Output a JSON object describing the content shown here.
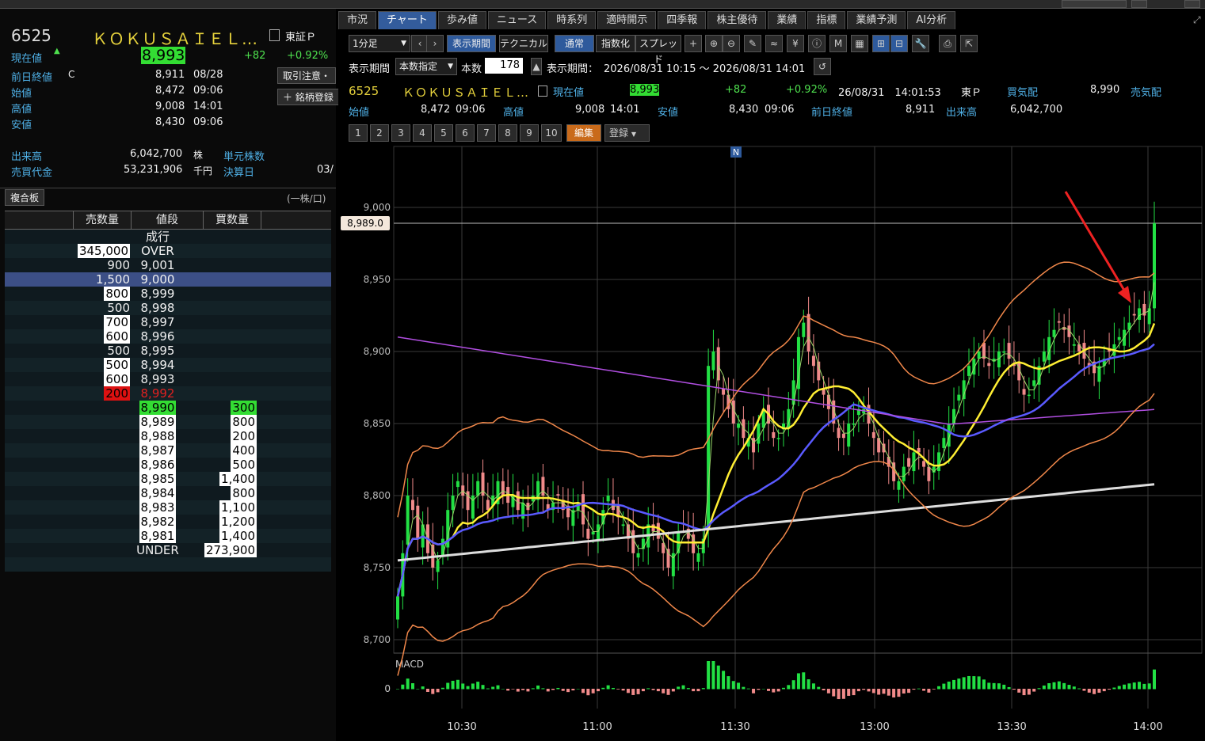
{
  "stock": {
    "code": "6525",
    "name": "ＫＯＫＵＳＡＩＥＬ…",
    "market": "東証Ｐ",
    "price_label": "現在値",
    "price": "8,993",
    "change": "+82",
    "change_pct": "+0.92%",
    "prev_close_label": "前日終値",
    "prev_close_flag": "C",
    "prev_close": "8,911",
    "prev_close_date": "08/28",
    "open_label": "始値",
    "open": "8,472",
    "open_time": "09:06",
    "high_label": "高値",
    "high": "9,008",
    "high_time": "14:01",
    "low_label": "安値",
    "low": "8,430",
    "low_time": "09:06",
    "volume_label": "出来高",
    "volume": "6,042,700",
    "volume_unit": "株",
    "trade_value_label": "売買代金",
    "trade_value": "53,231,906",
    "trade_value_unit": "千円",
    "unit_shares_label": "単元株数",
    "settlement_label": "決算日",
    "settlement_value": "03/",
    "trade_caution_btn": "取引注意・",
    "register_btn": "銘柄登録"
  },
  "book": {
    "title": "複合板",
    "unit": "(一株/口)",
    "headers": [
      "売数量",
      "値段",
      "買数量"
    ],
    "market_order": "成行",
    "rows": [
      {
        "ask": "345,000",
        "price": "OVER",
        "bid": "",
        "style": "box"
      },
      {
        "ask": "900",
        "price": "9,001",
        "bid": "",
        "style": ""
      },
      {
        "ask": "1,500",
        "price": "9,000",
        "bid": "",
        "style": "hl"
      },
      {
        "ask": "800",
        "price": "8,999",
        "bid": "",
        "style": "box"
      },
      {
        "ask": "500",
        "price": "8,998",
        "bid": "",
        "style": ""
      },
      {
        "ask": "700",
        "price": "8,997",
        "bid": "",
        "style": "box"
      },
      {
        "ask": "600",
        "price": "8,996",
        "bid": "",
        "style": "box"
      },
      {
        "ask": "500",
        "price": "8,995",
        "bid": "",
        "style": ""
      },
      {
        "ask": "500",
        "price": "8,994",
        "bid": "",
        "style": "box"
      },
      {
        "ask": "600",
        "price": "8,993",
        "bid": "",
        "style": "box"
      },
      {
        "ask": "200",
        "price": "8,992",
        "bid": "",
        "style": "red"
      },
      {
        "ask": "",
        "price": "8,990",
        "bid": "300",
        "style": "green"
      },
      {
        "ask": "",
        "price": "8,989",
        "bid": "800",
        "style": "boxb"
      },
      {
        "ask": "",
        "price": "8,988",
        "bid": "200",
        "style": "boxb"
      },
      {
        "ask": "",
        "price": "8,987",
        "bid": "400",
        "style": "boxb"
      },
      {
        "ask": "",
        "price": "8,986",
        "bid": "500",
        "style": "boxb"
      },
      {
        "ask": "",
        "price": "8,985",
        "bid": "1,400",
        "style": "boxb"
      },
      {
        "ask": "",
        "price": "8,984",
        "bid": "800",
        "style": "boxb"
      },
      {
        "ask": "",
        "price": "8,983",
        "bid": "1,100",
        "style": "boxb"
      },
      {
        "ask": "",
        "price": "8,982",
        "bid": "1,200",
        "style": "boxb"
      },
      {
        "ask": "",
        "price": "8,981",
        "bid": "1,400",
        "style": "boxb"
      },
      {
        "ask": "",
        "price": "UNDER",
        "bid": "273,900",
        "style": "boxb"
      }
    ]
  },
  "tabs": [
    "市況",
    "チャート",
    "歩み値",
    "ニュース",
    "時系列",
    "適時開示",
    "四季報",
    "株主優待",
    "業績",
    "指標",
    "業績予測",
    "AI分析"
  ],
  "toolbar": {
    "interval": "1分足",
    "period_btn": "表示期間",
    "technical_btn": "テクニカル",
    "normal_btn": "通常",
    "index_btn": "指数化",
    "spread_btn": "スプレッド",
    "period_label": "表示期間",
    "period_mode": "本数指定",
    "count_label": "本数",
    "count": "178",
    "range_label": "表示期間：",
    "range": "2026/08/31 10:15 ～ 2026/08/31 14:01",
    "pages": [
      "1",
      "2",
      "3",
      "4",
      "5",
      "6",
      "7",
      "8",
      "9",
      "10"
    ],
    "edit_btn": "編集",
    "register_btn": "登録"
  },
  "quote_bar": {
    "code": "6525",
    "name": "ＫＯＫＵＳＡＩＥＬ…",
    "price_label": "現在値",
    "price": "8,993",
    "change": "+82",
    "change_pct": "+0.92%",
    "timestamp": "26/08/31　14:01:53",
    "market": "東Ｐ",
    "bid_label": "買気配",
    "bid": "8,990",
    "ask_label": "売気配",
    "open_label": "始値",
    "open": "8,472",
    "open_time": "09:06",
    "high_label": "高値",
    "high": "9,008",
    "high_time": "14:01",
    "low_label": "安値",
    "low": "8,430",
    "low_time": "09:06",
    "prev_label": "前日終値",
    "prev": "8,911",
    "vol_label": "出来高",
    "vol": "6,042,700"
  },
  "colors": {
    "up": "#22e044",
    "down": "#f08a8a",
    "ma_fast": "#9bd66a",
    "ma_mid": "#ffee33",
    "ma_blue": "#5a5aff",
    "ma_white": "#dddddd",
    "ma_purple": "#b04ee0",
    "band": "#f0874a",
    "arrow": "#ee2222"
  },
  "chart_data": {
    "type": "candlestick",
    "y_ticks": [
      "9,000",
      "8,950",
      "8,900",
      "8,850",
      "8,800",
      "8,750",
      "8,700"
    ],
    "ylim": [
      8690,
      9030
    ],
    "x_ticks": [
      "10:30",
      "11:00",
      "11:30",
      "13:00",
      "13:30",
      "14:00"
    ],
    "news_marker": "N",
    "last_price_tag": "8,989.0",
    "macd_label": "MACD",
    "macd_zero": "0",
    "close_series": [
      8730,
      8760,
      8800,
      8790,
      8770,
      8780,
      8760,
      8750,
      8755,
      8770,
      8790,
      8800,
      8810,
      8800,
      8790,
      8800,
      8810,
      8800,
      8790,
      8800,
      8810,
      8800,
      8795,
      8800,
      8790,
      8795,
      8790,
      8800,
      8810,
      8800,
      8790,
      8795,
      8800,
      8790,
      8785,
      8790,
      8795,
      8780,
      8770,
      8775,
      8780,
      8790,
      8800,
      8790,
      8785,
      8780,
      8770,
      8760,
      8760,
      8770,
      8780,
      8775,
      8770,
      8760,
      8750,
      8760,
      8775,
      8780,
      8770,
      8760,
      8760,
      8770,
      8890,
      8900,
      8880,
      8870,
      8860,
      8850,
      8850,
      8840,
      8840,
      8830,
      8850,
      8860,
      8850,
      8840,
      8840,
      8850,
      8860,
      8880,
      8910,
      8920,
      8900,
      8890,
      8880,
      8870,
      8860,
      8850,
      8840,
      8840,
      8850,
      8850,
      8860,
      8860,
      8850,
      8840,
      8830,
      8830,
      8820,
      8810,
      8810,
      8820,
      8820,
      8830,
      8830,
      8820,
      8810,
      8820,
      8830,
      8840,
      8850,
      8860,
      8870,
      8880,
      8890,
      8895,
      8900,
      8895,
      8890,
      8895,
      8900,
      8900,
      8895,
      8890,
      8880,
      8870,
      8870,
      8880,
      8890,
      8900,
      8910,
      8915,
      8920,
      8915,
      8910,
      8905,
      8900,
      8895,
      8890,
      8885,
      8890,
      8895,
      8900,
      8905,
      8910,
      8915,
      8920,
      8925,
      8930,
      8925,
      8930,
      8989
    ]
  }
}
